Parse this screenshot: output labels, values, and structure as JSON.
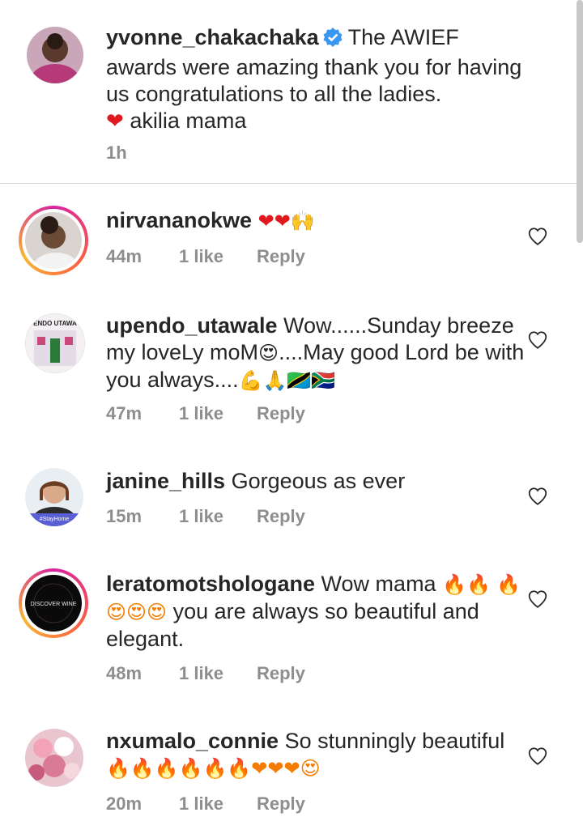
{
  "caption": {
    "username": "yvonne_chakachaka",
    "text": "The AWIEF awards were amazing thank you for having us congratulations to all the ladies.",
    "text_after_heart": "akilia mama",
    "time": "1h"
  },
  "comments": [
    {
      "username": "nirvananokwe",
      "text": "",
      "emoji": "❤❤🙌",
      "time": "44m",
      "likes": "1 like",
      "reply": "Reply"
    },
    {
      "username": "upendo_utawale",
      "text": "Wow......Sunday breeze my loveLy moM",
      "text2": "....May good Lord be with you always....",
      "emoji1": "😍",
      "emoji2": "💪🙏🇹🇿🇿🇦",
      "avatar_text": "ENDO UTAWA",
      "time": "47m",
      "likes": "1 like",
      "reply": "Reply"
    },
    {
      "username": "janine_hills",
      "text": "Gorgeous as ever",
      "avatar_text": "#StayHome",
      "time": "15m",
      "likes": "1 like",
      "reply": "Reply"
    },
    {
      "username": "leratomotshologane",
      "text": "Wow mama",
      "emoji1": "🔥🔥",
      "emoji2": "🔥😍😍😍",
      "text2": "you are always so beautiful and elegant.",
      "avatar_text": "DISCOVER WINE",
      "time": "48m",
      "likes": "1 like",
      "reply": "Reply"
    },
    {
      "username": "nxumalo_connie",
      "text": "So stunningly beautiful",
      "emoji": "🔥🔥🔥🔥🔥🔥❤❤❤😍",
      "time": "20m",
      "likes": "1 like",
      "reply": "Reply"
    }
  ],
  "icons": {
    "verified": "verified-badge-icon",
    "like": "heart-outline-icon"
  },
  "colors": {
    "verified_blue": "#3897f0",
    "meta_gray": "#8e8e8e",
    "heart_red": "#e0191f"
  }
}
